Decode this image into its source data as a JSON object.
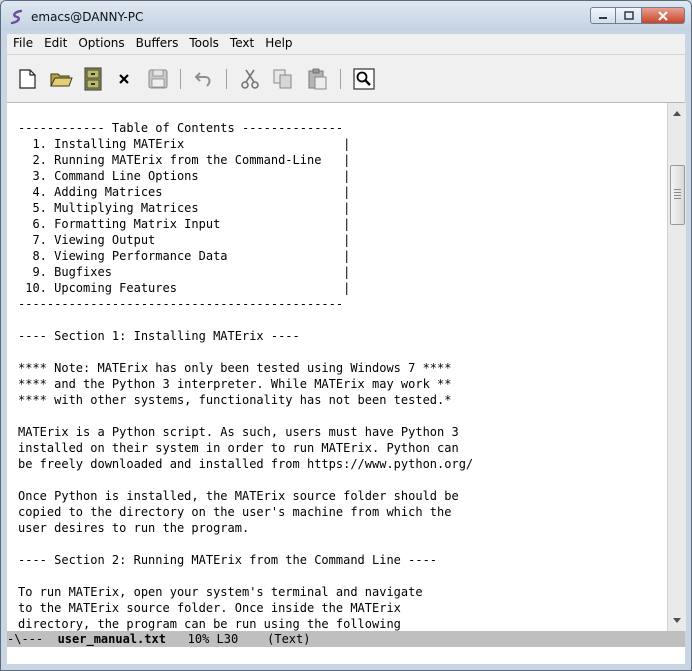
{
  "window": {
    "title": "emacs@DANNY-PC"
  },
  "menu": [
    "File",
    "Edit",
    "Options",
    "Buffers",
    "Tools",
    "Text",
    "Help"
  ],
  "toolbar": {
    "buttons": [
      "new-file",
      "open-file",
      "open-directory",
      "close-buffer",
      "save",
      "undo",
      "cut",
      "copy",
      "paste",
      "search"
    ]
  },
  "buffer": {
    "lines": [
      "------------ Table of Contents --------------",
      "  1. Installing MATErix                      |",
      "  2. Running MATErix from the Command-Line   |",
      "  3. Command Line Options                    |",
      "  4. Adding Matrices                         |",
      "  5. Multiplying Matrices                    |",
      "  6. Formatting Matrix Input                 |",
      "  7. Viewing Output                          |",
      "  8. Viewing Performance Data                |",
      "  9. Bugfixes                                |",
      " 10. Upcoming Features                       |",
      "---------------------------------------------",
      "",
      "---- Section 1: Installing MATErix ----",
      "",
      "**** Note: MATErix has only been tested using Windows 7 ****",
      "**** and the Python 3 interpreter. While MATErix may work **",
      "**** with other systems, functionality has not been tested.*",
      "",
      "MATErix is a Python script. As such, users must have Python 3",
      "installed on their system in order to run MATErix. Python can",
      "be freely downloaded and installed from https://www.python.org/",
      "",
      "Once Python is installed, the MATErix source folder should be",
      "copied to the directory on the user's machine from which the",
      "user desires to run the program.",
      "",
      "---- Section 2: Running MATErix from the Command Line ----",
      "",
      "To run MATErix, open your system's terminal and navigate",
      "to the MATErix source folder. Once inside the MATErix",
      "directory, the program can be run using the following"
    ]
  },
  "modeline": {
    "flags": "-\\---",
    "filename": "user_manual.txt",
    "position": "10% L30",
    "mode": "(Text)"
  },
  "colors": {
    "editor_bg": "#ffffff",
    "modeline_bg": "#bfbfbf",
    "chrome": "#f0f0f0",
    "close_button": "#c8442b"
  }
}
